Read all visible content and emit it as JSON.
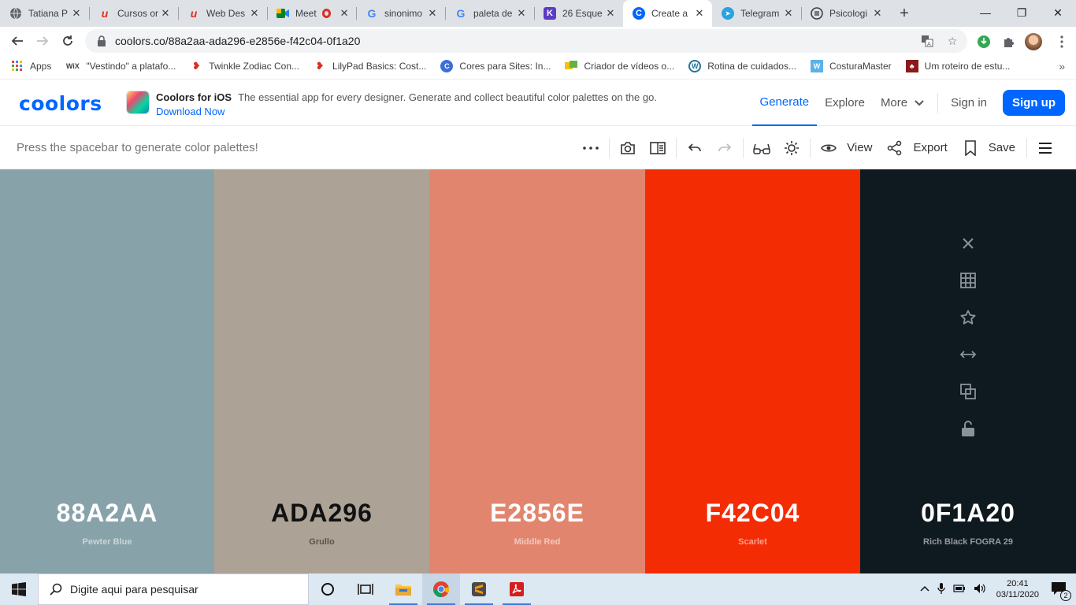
{
  "browser": {
    "tabs": [
      {
        "label": "Tatiana P",
        "icon": "globe-icon"
      },
      {
        "label": "Cursos or",
        "icon": "u-icon"
      },
      {
        "label": "Web Des",
        "icon": "u-icon"
      },
      {
        "label": "Meet",
        "icon": "meet-icon"
      },
      {
        "label": "sinonimo",
        "icon": "google-icon"
      },
      {
        "label": "paleta de",
        "icon": "google-icon"
      },
      {
        "label": "26 Esque",
        "icon": "k-icon"
      },
      {
        "label": "Create a",
        "icon": "coolors-icon"
      },
      {
        "label": "Telegram",
        "icon": "telegram-icon"
      },
      {
        "label": "Psicologi",
        "icon": "doc-icon"
      }
    ],
    "url": "coolors.co/88a2aa-ada296-e2856e-f42c04-0f1a20",
    "bookmarks": [
      {
        "label": "Apps"
      },
      {
        "label": "\"Vestindo\" a platafo..."
      },
      {
        "label": "Twinkle Zodiac Con..."
      },
      {
        "label": "LilyPad Basics: Cost..."
      },
      {
        "label": "Cores para Sites: In..."
      },
      {
        "label": "Criador de vídeos o..."
      },
      {
        "label": "Rotina de cuidados..."
      },
      {
        "label": "CosturaMaster"
      },
      {
        "label": "Um roteiro de estu..."
      }
    ]
  },
  "site": {
    "logo": "coolors",
    "promo_title": "Coolors for iOS",
    "promo_desc": "The essential app for every designer. Generate and collect beautiful color palettes on the go.",
    "promo_link": "Download Now",
    "nav": {
      "generate": "Generate",
      "explore": "Explore",
      "more": "More",
      "signin": "Sign in",
      "signup": "Sign up"
    }
  },
  "generator": {
    "hint": "Press the spacebar to generate color palettes!",
    "view": "View",
    "export": "Export",
    "save": "Save"
  },
  "palette": [
    {
      "hex": "88A2AA",
      "name": "Pewter Blue",
      "bg": "#88a2aa",
      "text": "#ffffff"
    },
    {
      "hex": "ADA296",
      "name": "Grullo",
      "bg": "#ada296",
      "text": "#111111"
    },
    {
      "hex": "E2856E",
      "name": "Middle Red",
      "bg": "#e2856e",
      "text": "#ffffff"
    },
    {
      "hex": "F42C04",
      "name": "Scarlet",
      "bg": "#f42c04",
      "text": "#ffffff"
    },
    {
      "hex": "0F1A20",
      "name": "Rich Black FOGRA 29",
      "bg": "#0f1a20",
      "text": "#ffffff"
    }
  ],
  "taskbar": {
    "search_placeholder": "Digite aqui para pesquisar",
    "time": "20:41",
    "date": "03/11/2020",
    "notifications": "2"
  }
}
